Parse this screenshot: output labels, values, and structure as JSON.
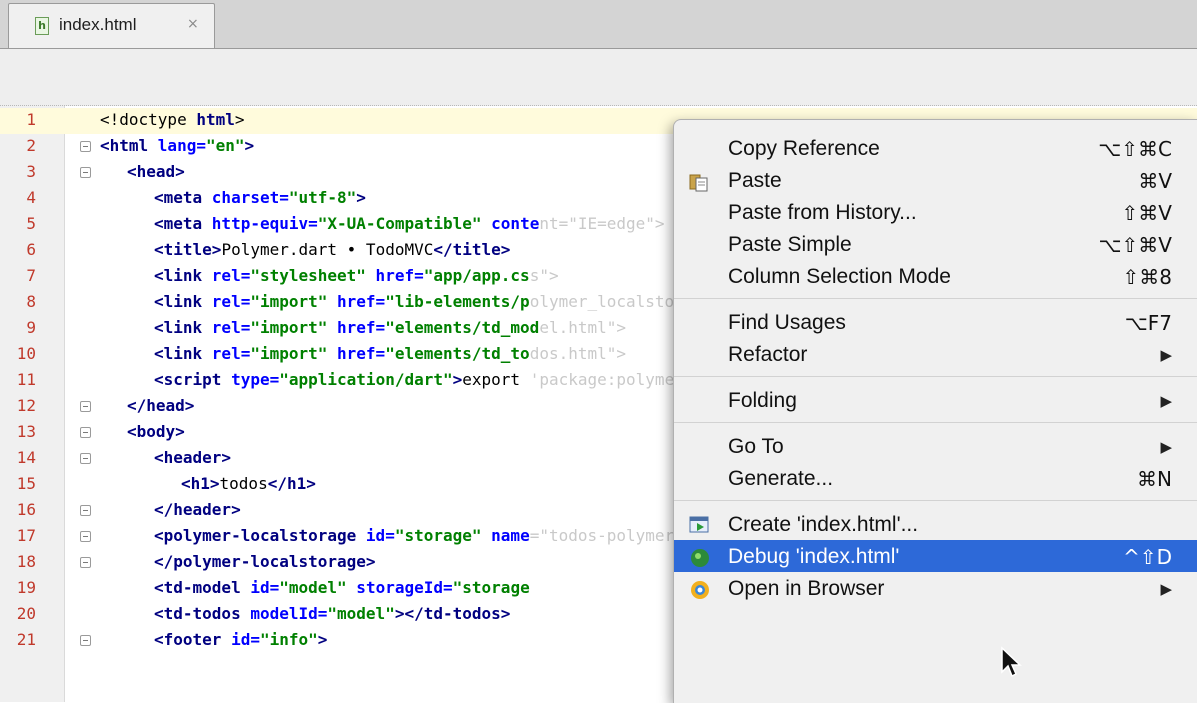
{
  "tabs": [
    {
      "label": "index.html",
      "close": "×",
      "file_icon": "html-file-icon"
    }
  ],
  "editor": {
    "current_line": 1,
    "lines": [
      {
        "n": "1",
        "indent": 0,
        "html": "<span class='txt'>&lt;!doctype </span><span class='tag'>html</span><span class='txt'>&gt;</span>"
      },
      {
        "n": "2",
        "indent": 0,
        "fold": true,
        "html": "<span class='tag'>&lt;html </span><span class='attr'>lang=</span><span class='val'>\"en\"</span><span class='tag'>&gt;</span>"
      },
      {
        "n": "3",
        "indent": 1,
        "fold": true,
        "html": "<span class='tag'>&lt;head&gt;</span>"
      },
      {
        "n": "4",
        "indent": 2,
        "html": "<span class='tag'>&lt;meta </span><span class='attr'>charset=</span><span class='val'>\"utf-8\"</span><span class='tag'>&gt;</span>"
      },
      {
        "n": "5",
        "indent": 2,
        "html": "<span class='tag'>&lt;meta </span><span class='attr'>http-equiv=</span><span class='val'>\"X-UA-Compatible\"</span><span class='attr'> conte</span><span class='ghost'>nt=\"IE=edge\"&gt;</span>"
      },
      {
        "n": "6",
        "indent": 2,
        "html": "<span class='tag'>&lt;title&gt;</span><span class='txt'>Polymer.dart • TodoMVC</span><span class='tag'>&lt;/title&gt;</span>"
      },
      {
        "n": "7",
        "indent": 2,
        "html": "<span class='tag'>&lt;link </span><span class='attr'>rel=</span><span class='val'>\"stylesheet\"</span><span class='attr'> href=</span><span class='val'>\"app/app.cs</span><span class='ghost'>s\"&gt;</span>"
      },
      {
        "n": "8",
        "indent": 2,
        "html": "<span class='tag'>&lt;link </span><span class='attr'>rel=</span><span class='val'>\"import\"</span><span class='attr'> href=</span><span class='val'>\"lib-elements/p</span><span class='ghost'>olymer_localstorage.html\"&gt;</span>"
      },
      {
        "n": "9",
        "indent": 2,
        "html": "<span class='tag'>&lt;link </span><span class='attr'>rel=</span><span class='val'>\"import\"</span><span class='attr'> href=</span><span class='val'>\"elements/td_mod</span><span class='ghost'>el.html\"&gt;</span>"
      },
      {
        "n": "10",
        "indent": 2,
        "html": "<span class='tag'>&lt;link </span><span class='attr'>rel=</span><span class='val'>\"import\"</span><span class='attr'> href=</span><span class='val'>\"elements/td_to</span><span class='ghost'>dos.html\"&gt;</span>"
      },
      {
        "n": "11",
        "indent": 2,
        "html": "<span class='tag'>&lt;script </span><span class='attr'>type=</span><span class='val'>\"application/dart\"</span><span class='tag'>&gt;</span><span class='txt'>export </span><span class='ghost'>'package:polymer/init.dart';&lt;/script&gt;</span>"
      },
      {
        "n": "12",
        "indent": 1,
        "fold": true,
        "html": "<span class='tag'>&lt;/head&gt;</span>"
      },
      {
        "n": "13",
        "indent": 1,
        "fold": true,
        "html": "<span class='tag'>&lt;body&gt;</span>"
      },
      {
        "n": "14",
        "indent": 2,
        "fold": true,
        "html": "<span class='tag'>&lt;header&gt;</span>"
      },
      {
        "n": "15",
        "indent": 3,
        "html": "<span class='tag'>&lt;h1&gt;</span><span class='txt'>todos</span><span class='tag'>&lt;/h1&gt;</span>"
      },
      {
        "n": "16",
        "indent": 2,
        "fold": true,
        "html": "<span class='tag'>&lt;/header&gt;</span>"
      },
      {
        "n": "17",
        "indent": 2,
        "fold": true,
        "html": "<span class='tag'>&lt;polymer-localstorage </span><span class='attr'>id=</span><span class='val'>\"storage\"</span><span class='attr'> name</span><span class='ghost'>=\"todos-polymer\"&gt;</span>"
      },
      {
        "n": "18",
        "indent": 2,
        "fold": true,
        "html": "<span class='tag'>&lt;/polymer-localstorage&gt;</span>"
      },
      {
        "n": "19",
        "indent": 2,
        "html": "<span class='tag'>&lt;td-model </span><span class='attr'>id=</span><span class='val'>\"model\"</span><span class='attr'> storageId=</span><span class='val'>\"storage</span>"
      },
      {
        "n": "20",
        "indent": 2,
        "html": "<span class='tag'>&lt;td-todos </span><span class='attr'>modelId=</span><span class='val'>\"model\"</span><span class='tag'>&gt;&lt;/td-todos&gt;</span>"
      },
      {
        "n": "21",
        "indent": 2,
        "fold": true,
        "html": "<span class='tag'>&lt;footer </span><span class='attr'>id=</span><span class='val'>\"info\"</span><span class='tag'>&gt;</span>"
      }
    ]
  },
  "context_menu": {
    "items": [
      {
        "type": "item",
        "name": "menu-item-copy-reference",
        "label": "Copy Reference",
        "shortcut": "⌥⇧⌘C"
      },
      {
        "type": "item",
        "name": "menu-item-paste",
        "label": "Paste",
        "shortcut": "⌘V",
        "icon": "paste-icon"
      },
      {
        "type": "item",
        "name": "menu-item-paste-from-history",
        "label": "Paste from History...",
        "shortcut": "⇧⌘V"
      },
      {
        "type": "item",
        "name": "menu-item-paste-simple",
        "label": "Paste Simple",
        "shortcut": "⌥⇧⌘V"
      },
      {
        "type": "item",
        "name": "menu-item-column-selection-mode",
        "label": "Column Selection Mode",
        "shortcut": "⇧⌘8"
      },
      {
        "type": "separator"
      },
      {
        "type": "item",
        "name": "menu-item-find-usages",
        "label": "Find Usages",
        "shortcut": "⌥F7"
      },
      {
        "type": "item",
        "name": "menu-item-refactor",
        "label": "Refactor",
        "submenu": true
      },
      {
        "type": "separator"
      },
      {
        "type": "item",
        "name": "menu-item-folding",
        "label": "Folding",
        "submenu": true
      },
      {
        "type": "separator"
      },
      {
        "type": "item",
        "name": "menu-item-go-to",
        "label": "Go To",
        "submenu": true
      },
      {
        "type": "item",
        "name": "menu-item-generate",
        "label": "Generate...",
        "shortcut": "⌘N"
      },
      {
        "type": "separator"
      },
      {
        "type": "item",
        "name": "menu-item-create-run-config",
        "label": "Create 'index.html'...",
        "icon": "run-config-icon"
      },
      {
        "type": "item",
        "name": "menu-item-debug",
        "label": "Debug 'index.html'",
        "shortcut": "^⇧D",
        "icon": "debug-icon",
        "highlighted": true
      },
      {
        "type": "item",
        "name": "menu-item-open-in-browser",
        "label": "Open in Browser",
        "submenu": true,
        "icon": "browser-icon"
      }
    ]
  },
  "colors": {
    "menu_highlight": "#2d69d8",
    "current_line_bg": "#fffbdc",
    "line_number": "#c0392b",
    "tag": "#000080",
    "attribute": "#0000ff",
    "string": "#008000"
  }
}
